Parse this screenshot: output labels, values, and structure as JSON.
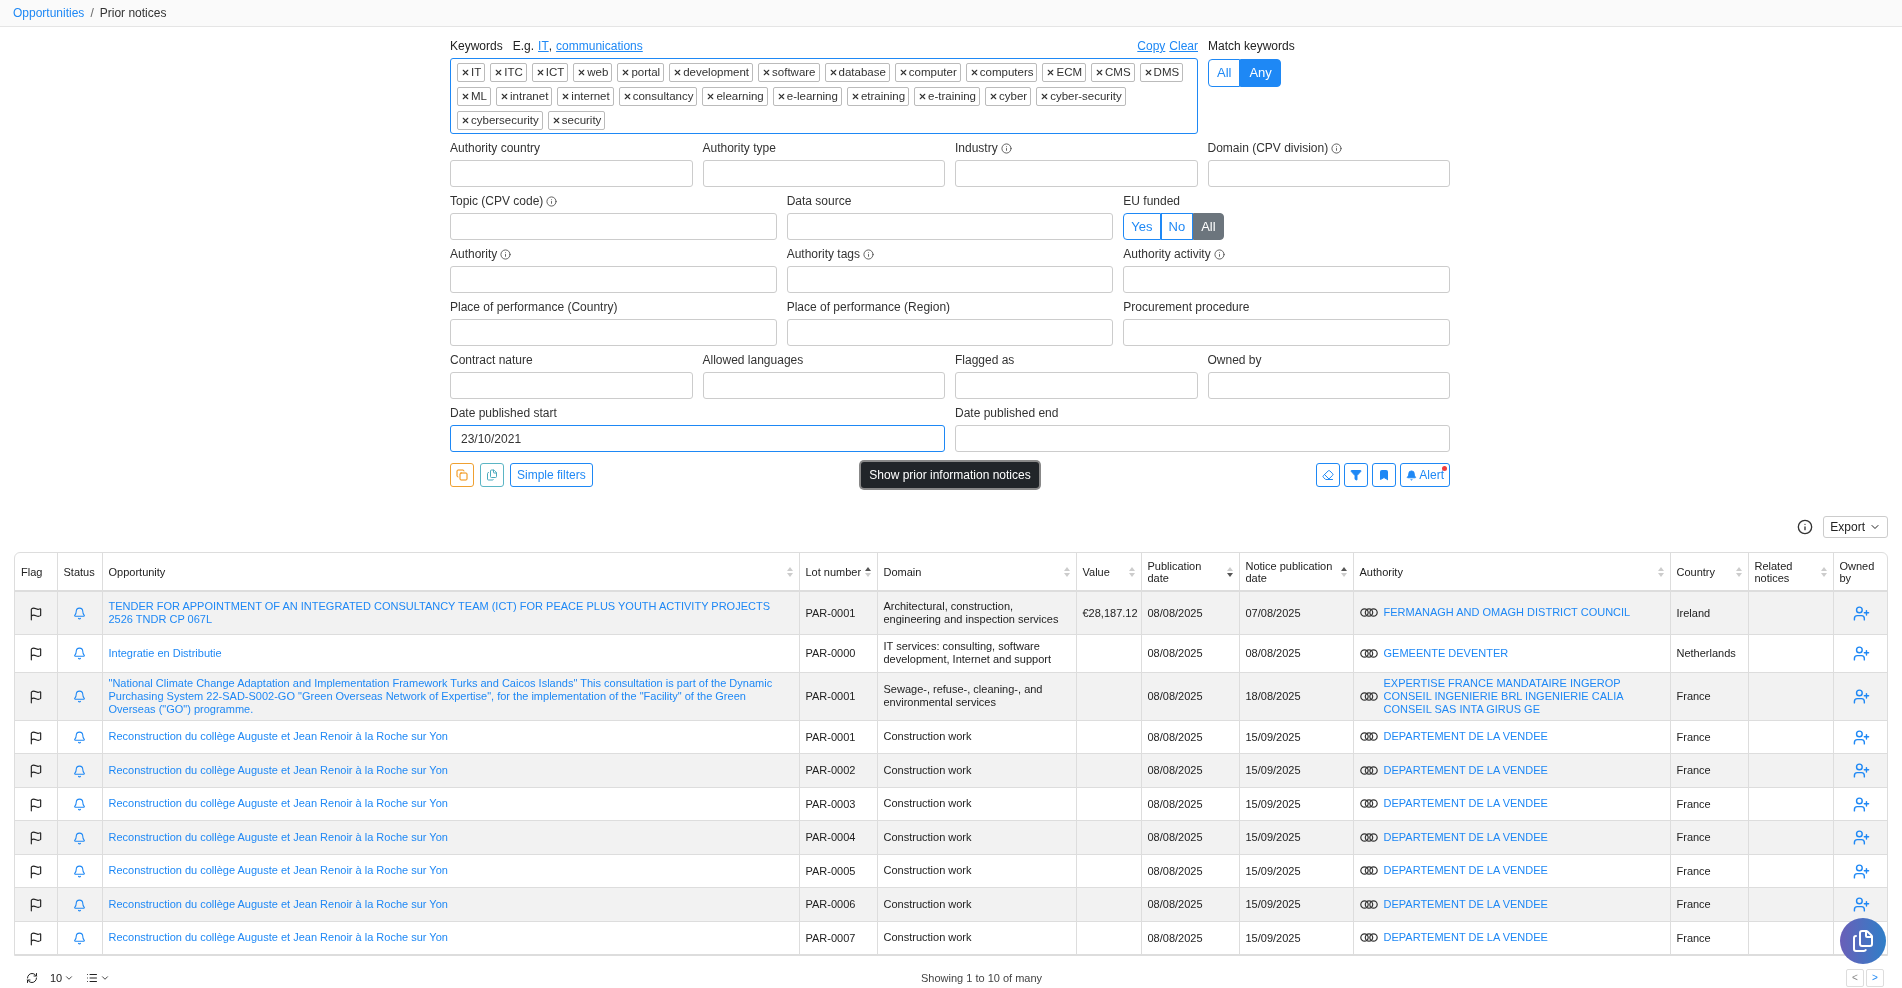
{
  "breadcrumb": [
    {
      "label": "Opportunities",
      "kind": "link"
    },
    {
      "label": "Prior notices",
      "kind": "current"
    }
  ],
  "breadcrumb_separator": "/",
  "keywords": {
    "label": "Keywords",
    "example_prefix": "E.g.",
    "examples": [
      "IT",
      "communications"
    ],
    "separator": ",",
    "actions": [
      "Copy",
      "Clear"
    ],
    "focused": true,
    "tags": [
      "IT",
      "ITC",
      "ICT",
      "web",
      "portal",
      "development",
      "software",
      "database",
      "computer",
      "computers",
      "ECM",
      "CMS",
      "DMS",
      "ML",
      "intranet",
      "internet",
      "consultancy",
      "elearning",
      "e-learning",
      "etraining",
      "e-training",
      "cyber",
      "cyber-security",
      "cybersecurity",
      "security"
    ]
  },
  "match_keywords": {
    "label": "Match keywords",
    "options": [
      {
        "label": "All",
        "selected": false
      },
      {
        "label": "Any",
        "selected": true
      }
    ]
  },
  "filter_rows": [
    {
      "fields": [
        {
          "kind": "input",
          "label": "Authority country",
          "info": false,
          "focused": false
        },
        {
          "kind": "input",
          "label": "Authority type",
          "info": false,
          "focused": false
        },
        {
          "kind": "input",
          "label": "Industry",
          "info": true,
          "focused": false
        },
        {
          "kind": "input",
          "label": "Domain (CPV division)",
          "info": true,
          "focused": false
        }
      ]
    },
    {
      "fields": [
        {
          "kind": "input",
          "label": "Topic (CPV code)",
          "info": true,
          "focused": false
        },
        {
          "kind": "input",
          "label": "Data source",
          "info": false,
          "focused": false
        },
        {
          "kind": "toggle",
          "label": "EU funded",
          "info": false,
          "options": [
            {
              "label": "Yes",
              "selected": false
            },
            {
              "label": "No",
              "selected": false
            },
            {
              "label": "All",
              "selected": true
            }
          ]
        }
      ]
    },
    {
      "fields": [
        {
          "kind": "input",
          "label": "Authority",
          "info": true,
          "focused": false
        },
        {
          "kind": "input",
          "label": "Authority tags",
          "info": true,
          "focused": false
        },
        {
          "kind": "input",
          "label": "Authority activity",
          "info": true,
          "focused": false
        }
      ]
    },
    {
      "fields": [
        {
          "kind": "input",
          "label": "Place of performance (Country)",
          "info": false,
          "focused": false
        },
        {
          "kind": "input",
          "label": "Place of performance (Region)",
          "info": false,
          "focused": false
        },
        {
          "kind": "input",
          "label": "Procurement procedure",
          "info": false,
          "focused": false
        }
      ]
    },
    {
      "fields": [
        {
          "kind": "input",
          "label": "Contract nature",
          "info": false,
          "focused": false
        },
        {
          "kind": "input",
          "label": "Allowed languages",
          "info": false,
          "focused": false
        },
        {
          "kind": "input",
          "label": "Flagged as",
          "info": false,
          "focused": false
        },
        {
          "kind": "input",
          "label": "Owned by",
          "info": false,
          "focused": false
        }
      ]
    },
    {
      "fields": [
        {
          "kind": "input",
          "label": "Date published start",
          "info": false,
          "value": "23/10/2021",
          "focused": true
        },
        {
          "kind": "input",
          "label": "Date published end",
          "info": false,
          "focused": false
        }
      ]
    }
  ],
  "actions": {
    "simple_filters": "Simple filters",
    "show": "Show prior information notices",
    "alert": {
      "label": "Alert",
      "notification": true
    }
  },
  "export": "Export",
  "table": {
    "columns": [
      {
        "label": "Flag",
        "sortable": false
      },
      {
        "label": "Status",
        "sortable": false
      },
      {
        "label": "Opportunity",
        "sortable": true,
        "sorted_ascending": false,
        "sorted_descending": false
      },
      {
        "label": "Lot number",
        "sortable": true,
        "sorted_ascending": true,
        "sorted_descending": false
      },
      {
        "label": "Domain",
        "sortable": true,
        "sorted_ascending": false,
        "sorted_descending": false
      },
      {
        "label": "Value",
        "sortable": true,
        "sorted_ascending": false,
        "sorted_descending": false
      },
      {
        "label": "Publication date",
        "sortable": true,
        "sorted_ascending": false,
        "sorted_descending": true
      },
      {
        "label": "Notice publication date",
        "sortable": true,
        "sorted_ascending": true,
        "sorted_descending": false
      },
      {
        "label": "Authority",
        "sortable": true,
        "sorted_ascending": false,
        "sorted_descending": false
      },
      {
        "label": "Country",
        "sortable": true,
        "sorted_ascending": false,
        "sorted_descending": false
      },
      {
        "label": "Related notices",
        "sortable": true,
        "sorted_ascending": false,
        "sorted_descending": false
      },
      {
        "label": "Owned by",
        "sortable": false
      }
    ],
    "rows": [
      {
        "opportunity": "TENDER FOR APPOINTMENT OF AN INTEGRATED CONSULTANCY TEAM (ICT) FOR PEACE PLUS YOUTH ACTIVITY PROJECTS 2526 TNDR CP 067L",
        "lot": "PAR-0001",
        "domain": "Architectural, construction, engineering and inspection services",
        "value": "€28,187.12",
        "publication_date": "08/08/2025",
        "notice_date": "07/08/2025",
        "authority": "FERMANAGH AND OMAGH DISTRICT COUNCIL",
        "country": "Ireland"
      },
      {
        "opportunity": "Integratie en Distributie",
        "lot": "PAR-0000",
        "domain": "IT services: consulting, software development, Internet and support",
        "publication_date": "08/08/2025",
        "notice_date": "08/08/2025",
        "authority": "GEMEENTE DEVENTER",
        "country": "Netherlands"
      },
      {
        "opportunity": "\"National Climate Change Adaptation and Implementation Framework Turks and Caicos Islands\" This consultation is part of the Dynamic Purchasing System 22-SAD-S002-GO \"Green Overseas Network of Expertise\", for the implementation of the \"Facility\" of the Green Overseas (\"GO\") programme.",
        "lot": "PAR-0001",
        "domain": "Sewage-, refuse-, cleaning-, and environmental services",
        "publication_date": "08/08/2025",
        "notice_date": "18/08/2025",
        "authority": "EXPERTISE FRANCE MANDATAIRE INGEROP CONSEIL INGENIERIE BRL INGENIERIE CALIA CONSEIL SAS INTA GIRUS GE",
        "country": "France"
      },
      {
        "opportunity": "Reconstruction du collège Auguste et Jean Renoir à la Roche sur Yon",
        "lot": "PAR-0001",
        "domain": "Construction work",
        "publication_date": "08/08/2025",
        "notice_date": "15/09/2025",
        "authority": "DEPARTEMENT DE LA VENDEE",
        "country": "France"
      },
      {
        "opportunity": "Reconstruction du collège Auguste et Jean Renoir à la Roche sur Yon",
        "lot": "PAR-0002",
        "domain": "Construction work",
        "publication_date": "08/08/2025",
        "notice_date": "15/09/2025",
        "authority": "DEPARTEMENT DE LA VENDEE",
        "country": "France"
      },
      {
        "opportunity": "Reconstruction du collège Auguste et Jean Renoir à la Roche sur Yon",
        "lot": "PAR-0003",
        "domain": "Construction work",
        "publication_date": "08/08/2025",
        "notice_date": "15/09/2025",
        "authority": "DEPARTEMENT DE LA VENDEE",
        "country": "France"
      },
      {
        "opportunity": "Reconstruction du collège Auguste et Jean Renoir à la Roche sur Yon",
        "lot": "PAR-0004",
        "domain": "Construction work",
        "publication_date": "08/08/2025",
        "notice_date": "15/09/2025",
        "authority": "DEPARTEMENT DE LA VENDEE",
        "country": "France"
      },
      {
        "opportunity": "Reconstruction du collège Auguste et Jean Renoir à la Roche sur Yon",
        "lot": "PAR-0005",
        "domain": "Construction work",
        "publication_date": "08/08/2025",
        "notice_date": "15/09/2025",
        "authority": "DEPARTEMENT DE LA VENDEE",
        "country": "France"
      },
      {
        "opportunity": "Reconstruction du collège Auguste et Jean Renoir à la Roche sur Yon",
        "lot": "PAR-0006",
        "domain": "Construction work",
        "publication_date": "08/08/2025",
        "notice_date": "15/09/2025",
        "authority": "DEPARTEMENT DE LA VENDEE",
        "country": "France"
      },
      {
        "opportunity": "Reconstruction du collège Auguste et Jean Renoir à la Roche sur Yon",
        "lot": "PAR-0007",
        "domain": "Construction work",
        "publication_date": "08/08/2025",
        "notice_date": "15/09/2025",
        "authority": "DEPARTEMENT DE LA VENDEE",
        "country": "France"
      }
    ]
  },
  "footer": {
    "page_size": "10",
    "status": "Showing 1 to 10 of many",
    "prev": {
      "label": "<",
      "disabled": true
    },
    "next": {
      "label": ">",
      "disabled": false
    }
  }
}
